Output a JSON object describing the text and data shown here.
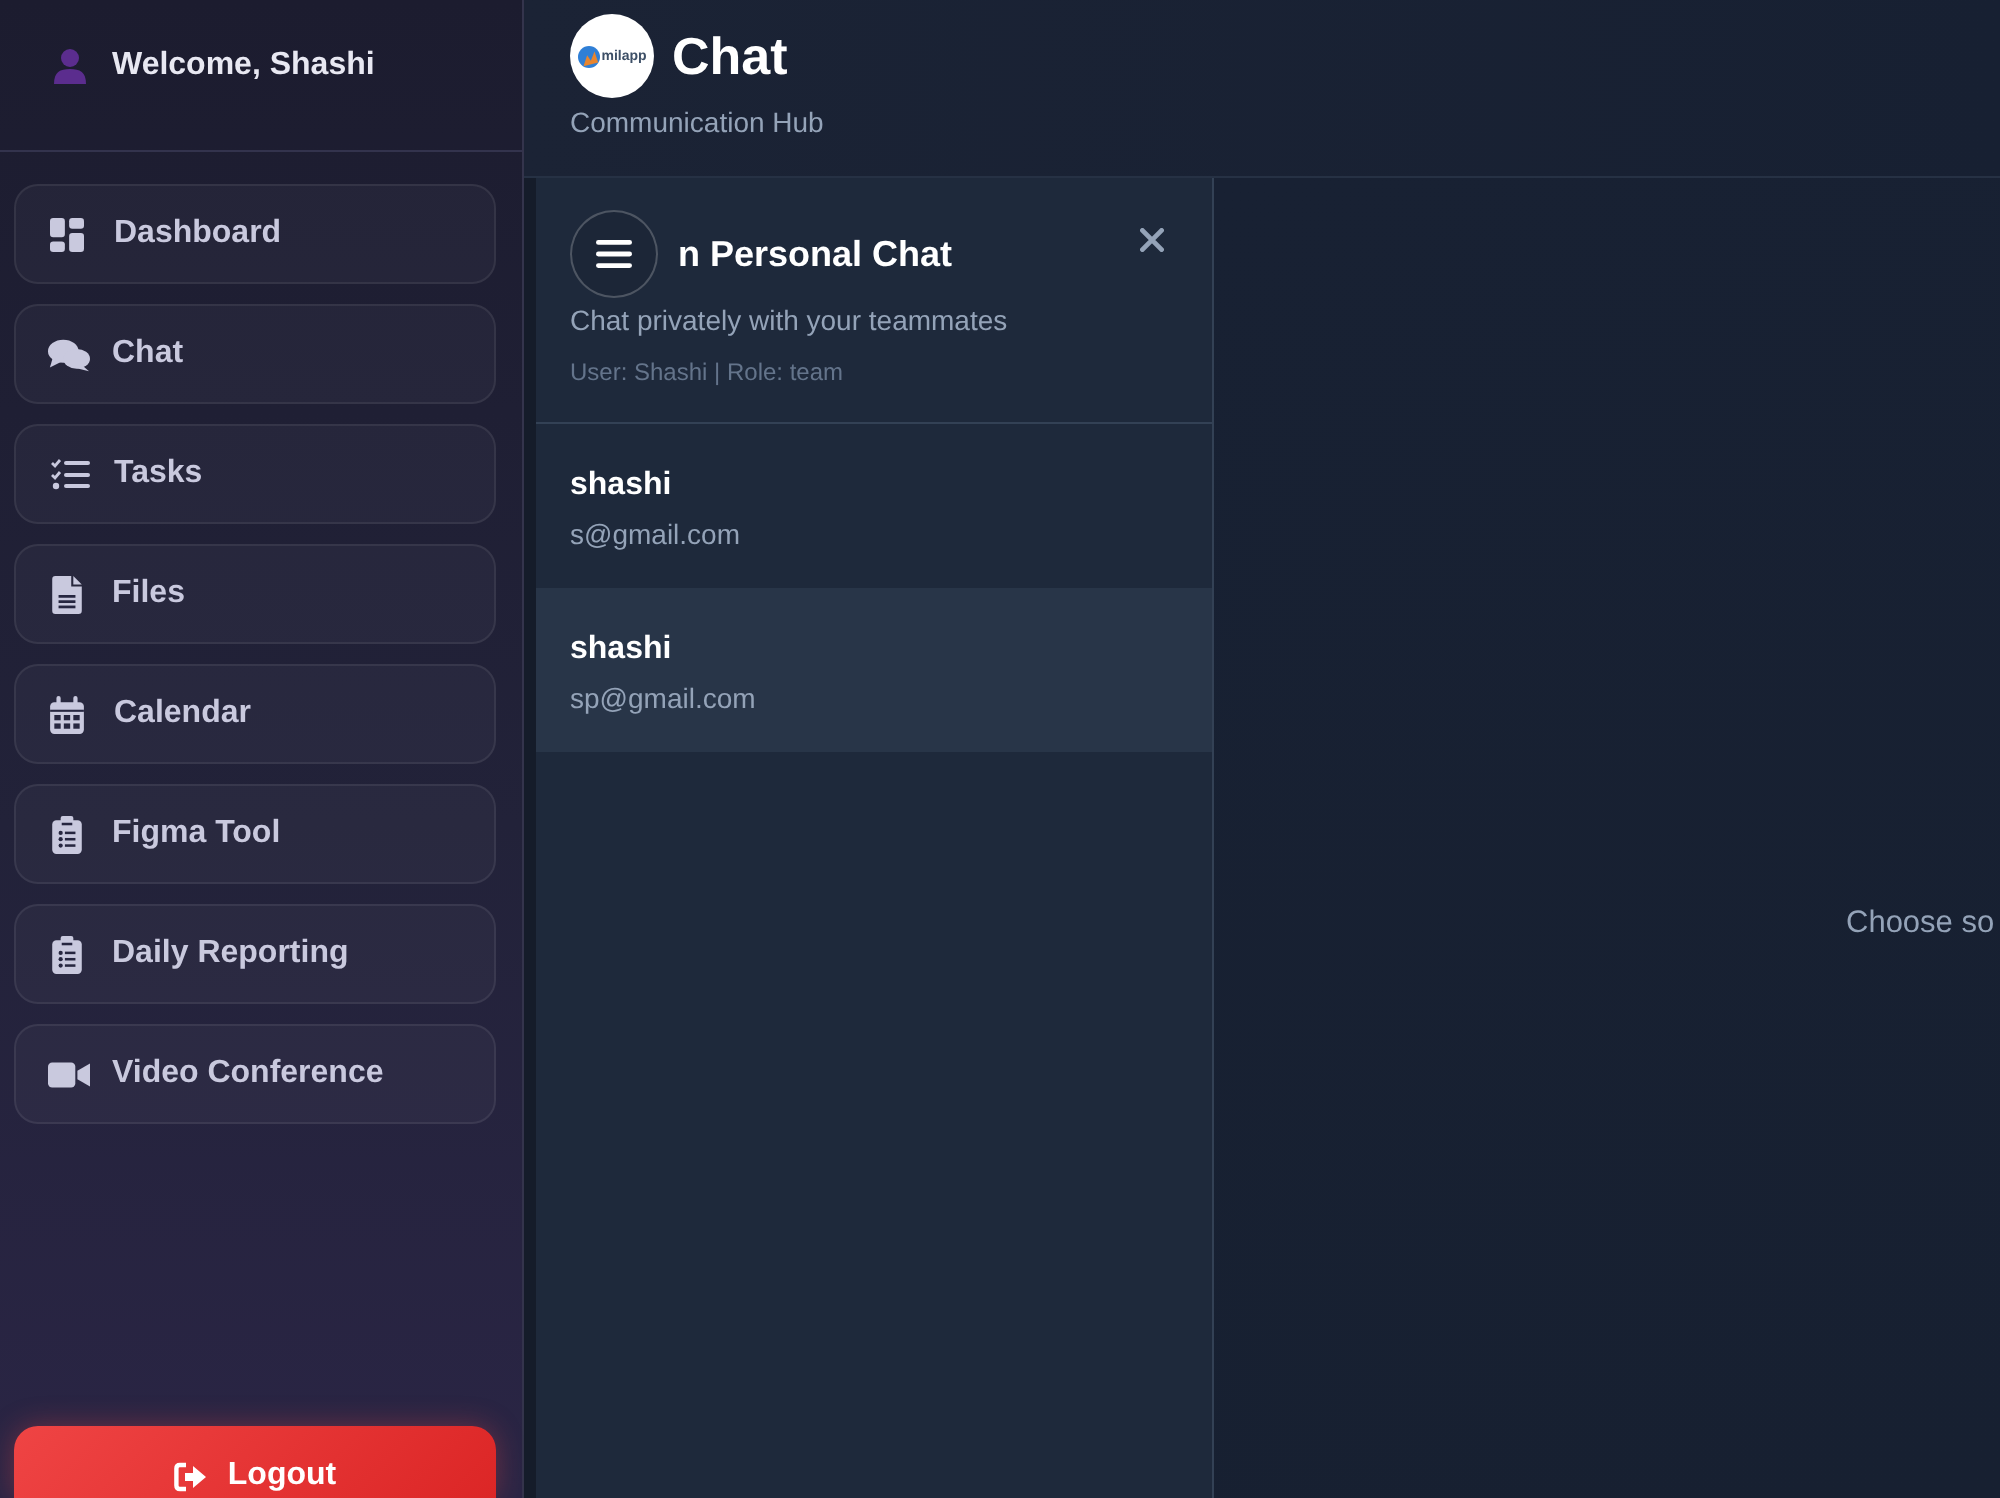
{
  "sidebar": {
    "welcome": "Welcome, Shashi",
    "items": [
      {
        "label": "Dashboard"
      },
      {
        "label": "Chat"
      },
      {
        "label": "Tasks"
      },
      {
        "label": "Files"
      },
      {
        "label": "Calendar"
      },
      {
        "label": "Figma Tool"
      },
      {
        "label": "Daily Reporting"
      },
      {
        "label": "Video Conference"
      }
    ],
    "logout": "Logout"
  },
  "header": {
    "logo_text": "milapp",
    "title": "Chat",
    "subtitle": "Communication Hub"
  },
  "chat_panel": {
    "title": "n Personal Chat",
    "subtitle": "Chat privately with your teammates",
    "meta": "User: Shashi | Role: team",
    "contacts": [
      {
        "name": "shashi",
        "email": "s@gmail.com",
        "selected": false
      },
      {
        "name": "shashi",
        "email": "sp@gmail.com",
        "selected": true
      }
    ]
  },
  "conversation": {
    "empty_message": "Choose so"
  }
}
